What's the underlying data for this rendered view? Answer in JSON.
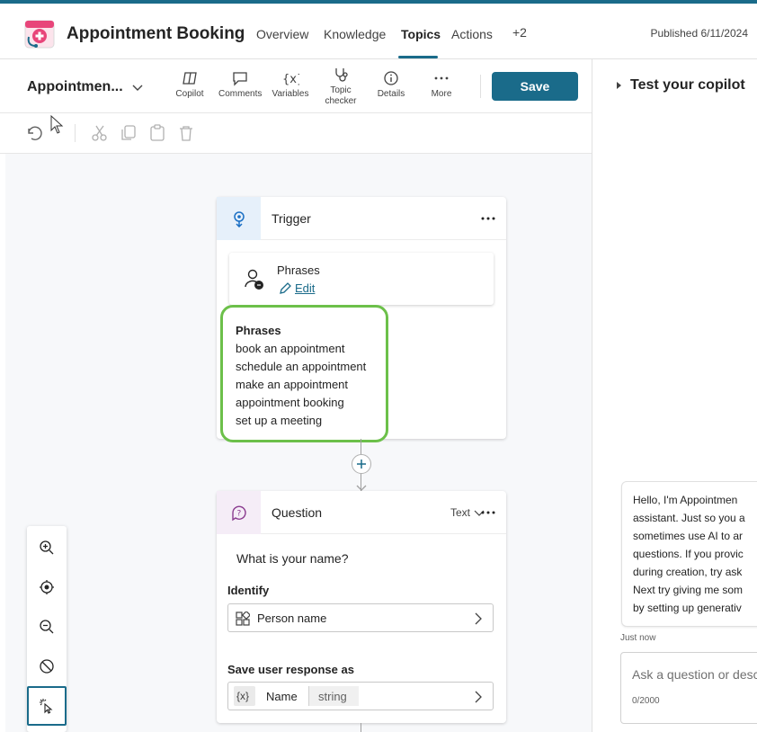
{
  "header": {
    "app_title": "Appointment Booking",
    "tabs": [
      {
        "label": "Overview"
      },
      {
        "label": "Knowledge"
      },
      {
        "label": "Topics",
        "active": true
      },
      {
        "label": "Actions"
      },
      {
        "label": "+2"
      }
    ],
    "published": "Published 6/11/2024"
  },
  "toolbar": {
    "topic_name": "Appointmen...",
    "tools": [
      {
        "label": "Copilot",
        "icon": "copilot-icon"
      },
      {
        "label": "Comments",
        "icon": "comment-icon"
      },
      {
        "label": "Variables",
        "icon": "variables-icon"
      },
      {
        "label": "Topic\nchecker",
        "icon": "stethoscope-icon"
      },
      {
        "label": "Details",
        "icon": "info-icon"
      },
      {
        "label": "More",
        "icon": "more-icon"
      }
    ],
    "save_label": "Save",
    "accent": "#1a6b8a"
  },
  "canvas": {
    "trigger": {
      "title": "Trigger",
      "phrases_card_title": "Phrases",
      "edit_label": "Edit"
    },
    "phrases_popup": {
      "title": "Phrases",
      "items": [
        "book an appointment",
        "schedule an appointment",
        "make an appointment",
        "appointment booking",
        "set up a meeting"
      ],
      "highlight_color": "#6cc04a"
    },
    "question": {
      "title": "Question",
      "type": "Text",
      "prompt": "What is your name?",
      "identify_label": "Identify",
      "identify_value": "Person name",
      "save_label": "Save user response as",
      "var_symbol": "{x}",
      "var_name": "Name",
      "var_type": "string"
    }
  },
  "test_panel": {
    "title": "Test your copilot",
    "bot_message_lines": [
      "Hello, I'm Appointmen",
      "assistant. Just so you a",
      "sometimes use AI to ar",
      "questions. If you provic",
      "during creation, try ask",
      "Next try giving me som",
      "by setting up generativ"
    ],
    "timestamp": "Just now",
    "input_placeholder": "Ask a question or desc",
    "char_count": "0/2000"
  }
}
